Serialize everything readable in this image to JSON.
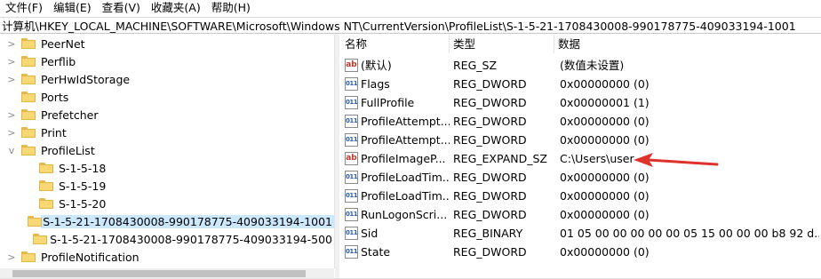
{
  "menu": [
    "文件(F)",
    "编辑(E)",
    "查看(V)",
    "收藏夹(A)",
    "帮助(H)"
  ],
  "address": "计算机\\HKEY_LOCAL_MACHINE\\SOFTWARE\\Microsoft\\Windows NT\\CurrentVersion\\ProfileList\\S-1-5-21-1708430008-990178775-409033194-1001",
  "tree": [
    {
      "label": "PeerNet",
      "chev": ">"
    },
    {
      "label": "Perflib",
      "chev": ">"
    },
    {
      "label": "PerHwIdStorage",
      "chev": ">"
    },
    {
      "label": "Ports",
      "chev": ""
    },
    {
      "label": "Prefetcher",
      "chev": ">"
    },
    {
      "label": "Print",
      "chev": ">"
    },
    {
      "label": "ProfileList",
      "chev": "v"
    },
    {
      "label": "S-1-5-18",
      "chev": ""
    },
    {
      "label": "S-1-5-19",
      "chev": ""
    },
    {
      "label": "S-1-5-20",
      "chev": ""
    },
    {
      "label": "S-1-5-21-1708430008-990178775-409033194-1001",
      "chev": ""
    },
    {
      "label": "S-1-5-21-1708430008-990178775-409033194-500",
      "chev": ""
    },
    {
      "label": "ProfileNotification",
      "chev": ">"
    }
  ],
  "columns": {
    "name": "名称",
    "type": "类型",
    "data": "数据"
  },
  "values": [
    {
      "icon": "ab",
      "name": "(默认)",
      "type": "REG_SZ",
      "data": "(数值未设置)"
    },
    {
      "icon": "bin",
      "name": "Flags",
      "type": "REG_DWORD",
      "data": "0x00000000 (0)"
    },
    {
      "icon": "bin",
      "name": "FullProfile",
      "type": "REG_DWORD",
      "data": "0x00000001 (1)"
    },
    {
      "icon": "bin",
      "name": "ProfileAttempt...",
      "type": "REG_DWORD",
      "data": "0x00000000 (0)"
    },
    {
      "icon": "bin",
      "name": "ProfileAttempt...",
      "type": "REG_DWORD",
      "data": "0x00000000 (0)"
    },
    {
      "icon": "ab",
      "name": "ProfileImageP...",
      "type": "REG_EXPAND_SZ",
      "data": "C:\\Users\\user"
    },
    {
      "icon": "bin",
      "name": "ProfileLoadTim...",
      "type": "REG_DWORD",
      "data": "0x00000000 (0)"
    },
    {
      "icon": "bin",
      "name": "ProfileLoadTim...",
      "type": "REG_DWORD",
      "data": "0x00000000 (0)"
    },
    {
      "icon": "bin",
      "name": "RunLogonScri...",
      "type": "REG_DWORD",
      "data": "0x00000000 (0)"
    },
    {
      "icon": "bin",
      "name": "Sid",
      "type": "REG_BINARY",
      "data": "01 05 00 00 00 00 00 05 15 00 00 00 b8 92 d..."
    },
    {
      "icon": "bin",
      "name": "State",
      "type": "REG_DWORD",
      "data": "0x00000000 (0)"
    }
  ],
  "annotation_color": "#e0322d"
}
